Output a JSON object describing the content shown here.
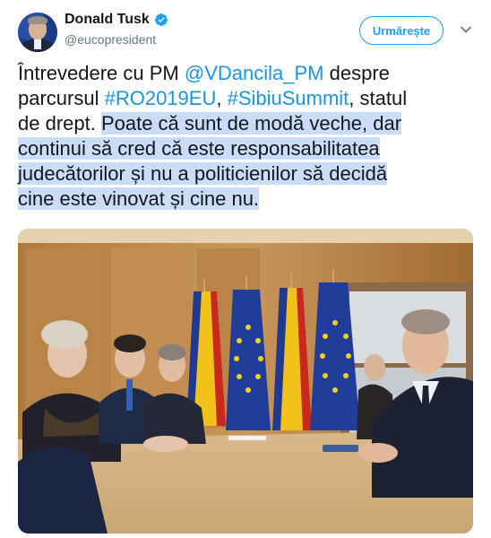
{
  "author": {
    "display_name": "Donald Tusk",
    "handle": "@eucopresident",
    "verified": true,
    "avatar_icon": "avatar-photo"
  },
  "actions": {
    "follow_label": "Urmărește",
    "more_icon": "chevron-down-icon"
  },
  "tweet": {
    "lines": [
      [
        {
          "t": "Întrevedere cu PM "
        },
        {
          "t": "@VDancila_PM",
          "link": true
        },
        {
          "t": " despre"
        }
      ],
      [
        {
          "t": "parcursul "
        },
        {
          "t": "#RO2019EU",
          "link": true
        },
        {
          "t": ", "
        },
        {
          "t": "#SibiuSummit",
          "link": true
        },
        {
          "t": ", statul"
        }
      ],
      [
        {
          "t": "de drept. "
        },
        {
          "t": "Poate că sunt de modă veche, dar",
          "hl": true
        }
      ],
      [
        {
          "t": "continui să cred că este responsabilitatea",
          "hl": true
        }
      ],
      [
        {
          "t": "judecătorilor și nu a politicienilor să decidă",
          "hl": true
        }
      ],
      [
        {
          "t": "cine este vinovat și cine nu.",
          "hl": true
        }
      ]
    ]
  },
  "media": {
    "type": "photo"
  },
  "colors": {
    "accent": "#1da1f2",
    "link": "#1b95e0",
    "highlight": "#c9ddf9",
    "text": "#14171a",
    "secondary": "#657786"
  }
}
